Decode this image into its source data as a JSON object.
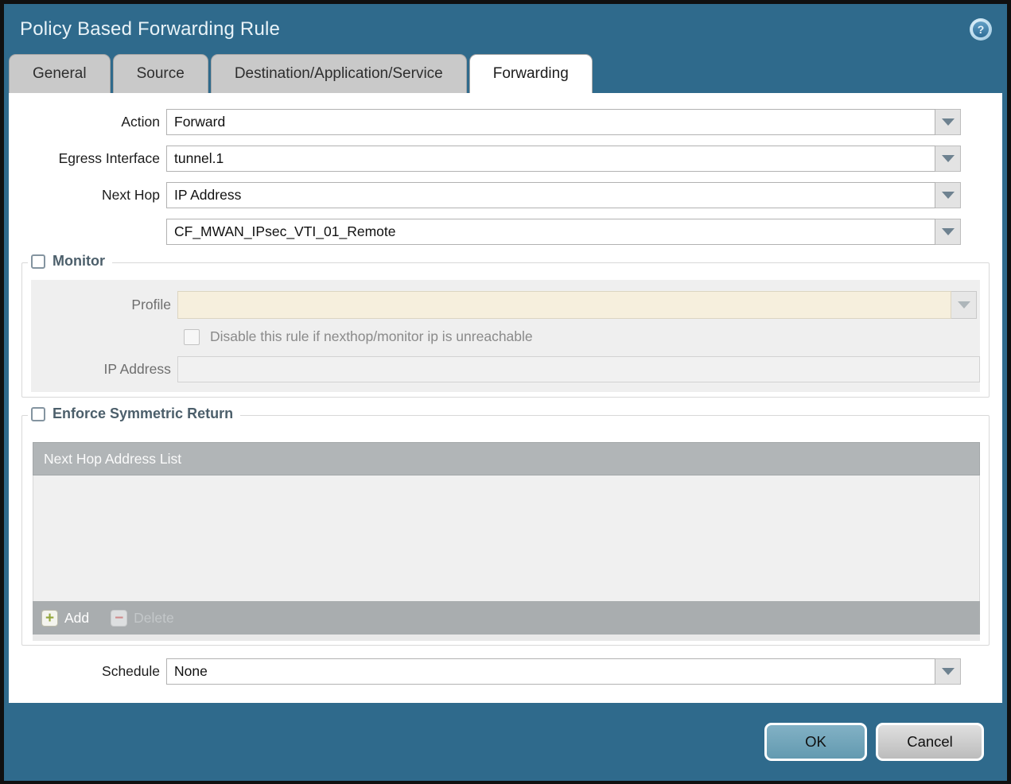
{
  "dialog": {
    "title": "Policy Based Forwarding Rule",
    "tabs": [
      {
        "label": "General",
        "active": false
      },
      {
        "label": "Source",
        "active": false
      },
      {
        "label": "Destination/Application/Service",
        "active": false
      },
      {
        "label": "Forwarding",
        "active": true
      }
    ]
  },
  "form": {
    "action": {
      "label": "Action",
      "value": "Forward"
    },
    "egress_interface": {
      "label": "Egress Interface",
      "value": "tunnel.1"
    },
    "next_hop": {
      "label": "Next Hop",
      "value": "IP Address"
    },
    "next_hop_address": {
      "value": "CF_MWAN_IPsec_VTI_01_Remote"
    },
    "schedule": {
      "label": "Schedule",
      "value": "None"
    }
  },
  "monitor": {
    "legend": "Monitor",
    "checked": false,
    "profile": {
      "label": "Profile",
      "value": ""
    },
    "disable_rule": {
      "label": "Disable this rule if nexthop/monitor ip is unreachable",
      "checked": false
    },
    "ip_address": {
      "label": "IP Address",
      "value": ""
    }
  },
  "symmetric_return": {
    "legend": "Enforce Symmetric Return",
    "checked": false,
    "table": {
      "header": "Next Hop Address List",
      "rows": []
    },
    "add_label": "Add",
    "delete_label": "Delete",
    "delete_enabled": false
  },
  "footer": {
    "ok_label": "OK",
    "cancel_label": "Cancel"
  },
  "icons": {
    "help": "question-circle-icon",
    "dropdown": "chevron-down-icon",
    "add": "plus-icon",
    "delete": "minus-icon"
  },
  "colors": {
    "dialog_teal": "#2f6a8c",
    "active_tab": "#ffffff",
    "inactive_tab": "#c9c9c9",
    "disabled_field_cream": "#f6efdd",
    "table_header": "#b1b5b7",
    "ok_button": "#6fa2b9",
    "legend_text": "#4c5f6b",
    "add_icon_green": "#93a63b",
    "delete_icon_red": "#d08b8b"
  }
}
